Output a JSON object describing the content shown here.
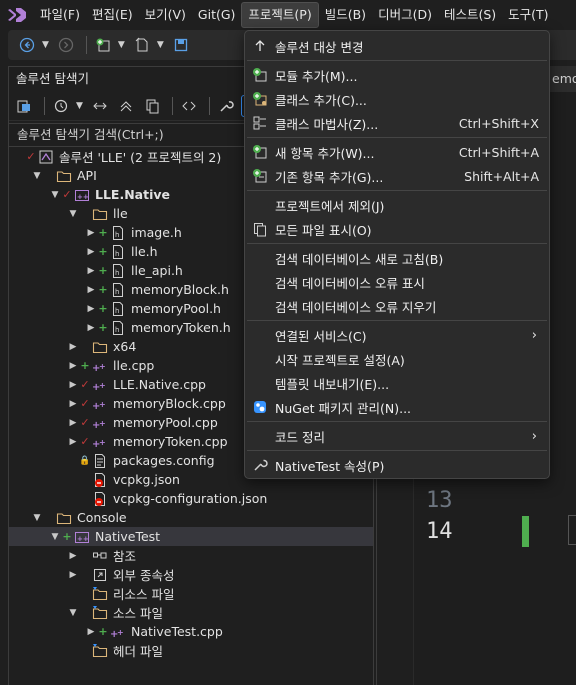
{
  "menubar": {
    "items": [
      "파일(F)",
      "편집(E)",
      "보기(V)",
      "Git(G)",
      "프로젝트(P)",
      "빌드(B)",
      "디버그(D)",
      "테스트(S)",
      "도구(T)"
    ],
    "active_index": 4
  },
  "toolbar": {
    "run_label": "▶ "
  },
  "solution_explorer": {
    "title": "솔루션 탐색기",
    "search_placeholder": "솔루션 탐색기 검색(Ctrl+;)",
    "tree": [
      {
        "label": "솔루션 'LLE'  (2 프로젝트의 2)",
        "depth": 0,
        "expander": "",
        "status": "check",
        "icon": "solution-icon",
        "bold": false
      },
      {
        "label": "API",
        "depth": 1,
        "expander": "▼",
        "status": "",
        "icon": "folder-icon",
        "bold": false
      },
      {
        "label": "LLE.Native",
        "depth": 2,
        "expander": "▼",
        "status": "check",
        "icon": "cpp-project-icon",
        "bold": true
      },
      {
        "label": "lle",
        "depth": 3,
        "expander": "▼",
        "status": "",
        "icon": "folder-icon",
        "bold": false
      },
      {
        "label": "image.h",
        "depth": 4,
        "expander": "▶",
        "status": "plus",
        "icon": "header-file-icon",
        "bold": false
      },
      {
        "label": "lle.h",
        "depth": 4,
        "expander": "▶",
        "status": "plus",
        "icon": "header-file-icon",
        "bold": false
      },
      {
        "label": "lle_api.h",
        "depth": 4,
        "expander": "▶",
        "status": "plus",
        "icon": "header-file-icon",
        "bold": false
      },
      {
        "label": "memoryBlock.h",
        "depth": 4,
        "expander": "▶",
        "status": "plus",
        "icon": "header-file-icon",
        "bold": false
      },
      {
        "label": "memoryPool.h",
        "depth": 4,
        "expander": "▶",
        "status": "plus",
        "icon": "header-file-icon",
        "bold": false
      },
      {
        "label": "memoryToken.h",
        "depth": 4,
        "expander": "▶",
        "status": "plus",
        "icon": "header-file-icon",
        "bold": false
      },
      {
        "label": "x64",
        "depth": 3,
        "expander": "▶",
        "status": "",
        "icon": "folder-icon",
        "bold": false
      },
      {
        "label": "lle.cpp",
        "depth": 3,
        "expander": "▶",
        "status": "plus",
        "icon": "cpp-file-icon",
        "bold": false
      },
      {
        "label": "LLE.Native.cpp",
        "depth": 3,
        "expander": "▶",
        "status": "check",
        "icon": "cpp-file-icon",
        "bold": false
      },
      {
        "label": "memoryBlock.cpp",
        "depth": 3,
        "expander": "▶",
        "status": "check",
        "icon": "cpp-file-icon",
        "bold": false
      },
      {
        "label": "memoryPool.cpp",
        "depth": 3,
        "expander": "▶",
        "status": "check",
        "icon": "cpp-file-icon",
        "bold": false
      },
      {
        "label": "memoryToken.cpp",
        "depth": 3,
        "expander": "▶",
        "status": "check",
        "icon": "cpp-file-icon",
        "bold": false
      },
      {
        "label": "packages.config",
        "depth": 3,
        "expander": "",
        "status": "lock",
        "icon": "config-file-icon",
        "bold": false
      },
      {
        "label": "vcpkg.json",
        "depth": 3,
        "expander": "",
        "status": "",
        "icon": "json-error-icon",
        "bold": false
      },
      {
        "label": "vcpkg-configuration.json",
        "depth": 3,
        "expander": "",
        "status": "",
        "icon": "json-error-icon",
        "bold": false
      },
      {
        "label": "Console",
        "depth": 1,
        "expander": "▼",
        "status": "",
        "icon": "folder-icon",
        "bold": false
      },
      {
        "label": "NativeTest",
        "depth": 2,
        "expander": "▼",
        "status": "plus",
        "icon": "cpp-project-icon",
        "bold": false,
        "selected": true
      },
      {
        "label": "참조",
        "depth": 3,
        "expander": "▶",
        "status": "",
        "icon": "references-icon",
        "bold": false
      },
      {
        "label": "외부 종속성",
        "depth": 3,
        "expander": "▶",
        "status": "",
        "icon": "external-deps-icon",
        "bold": false
      },
      {
        "label": "리소스 파일",
        "depth": 3,
        "expander": "",
        "status": "",
        "icon": "filter-folder-icon",
        "bold": false
      },
      {
        "label": "소스 파일",
        "depth": 3,
        "expander": "▼",
        "status": "",
        "icon": "filter-folder-icon",
        "bold": false
      },
      {
        "label": "NativeTest.cpp",
        "depth": 4,
        "expander": "▶",
        "status": "plus",
        "icon": "cpp-file-icon",
        "bold": false
      },
      {
        "label": "헤더 파일",
        "depth": 3,
        "expander": "",
        "status": "",
        "icon": "filter-folder-icon",
        "bold": false
      }
    ]
  },
  "editor": {
    "tab_label": "emor",
    "line_numbers": [
      "13",
      "14"
    ]
  },
  "project_menu": {
    "items": [
      {
        "label": "솔루션 대상 변경",
        "shortcut": "",
        "icon": "arrow-up-icon",
        "submenu": false,
        "sep_after": true
      },
      {
        "label": "모듈 추가(M)...",
        "shortcut": "",
        "icon": "add-module-icon",
        "submenu": false,
        "sep_after": false
      },
      {
        "label": "클래스 추가(C)...",
        "shortcut": "",
        "icon": "add-class-icon",
        "submenu": false,
        "sep_after": false
      },
      {
        "label": "클래스 마법사(Z)...",
        "shortcut": "Ctrl+Shift+X",
        "icon": "class-wizard-icon",
        "submenu": false,
        "sep_after": true
      },
      {
        "label": "새 항목 추가(W)...",
        "shortcut": "Ctrl+Shift+A",
        "icon": "add-new-item-icon",
        "submenu": false,
        "sep_after": false
      },
      {
        "label": "기존 항목 추가(G)...",
        "shortcut": "Shift+Alt+A",
        "icon": "add-existing-item-icon",
        "submenu": false,
        "sep_after": true
      },
      {
        "label": "프로젝트에서 제외(J)",
        "shortcut": "",
        "icon": "",
        "submenu": false,
        "sep_after": false
      },
      {
        "label": "모든 파일 표시(O)",
        "shortcut": "",
        "icon": "show-all-files-icon",
        "submenu": false,
        "sep_after": true
      },
      {
        "label": "검색 데이터베이스 새로 고침(B)",
        "shortcut": "",
        "icon": "",
        "submenu": false,
        "sep_after": false
      },
      {
        "label": "검색 데이터베이스 오류 표시",
        "shortcut": "",
        "icon": "",
        "submenu": false,
        "sep_after": false
      },
      {
        "label": "검색 데이터베이스 오류 지우기",
        "shortcut": "",
        "icon": "",
        "submenu": false,
        "sep_after": true
      },
      {
        "label": "연결된 서비스(C)",
        "shortcut": "",
        "icon": "",
        "submenu": true,
        "sep_after": false
      },
      {
        "label": "시작 프로젝트로 설정(A)",
        "shortcut": "",
        "icon": "",
        "submenu": false,
        "sep_after": false
      },
      {
        "label": "템플릿 내보내기(E)...",
        "shortcut": "",
        "icon": "",
        "submenu": false,
        "sep_after": false
      },
      {
        "label": "NuGet 패키지 관리(N)...",
        "shortcut": "",
        "icon": "nuget-icon",
        "submenu": false,
        "sep_after": true
      },
      {
        "label": "코드 정리",
        "shortcut": "",
        "icon": "",
        "submenu": true,
        "sep_after": true
      },
      {
        "label": "NativeTest 속성(P)",
        "shortcut": "",
        "icon": "wrench-icon",
        "submenu": false,
        "sep_after": false
      }
    ]
  },
  "colors": {
    "accent": "#3794ff",
    "vs_purple": "#b180d7",
    "modified_check": "#c23a3a",
    "added_plus": "#4fae4f",
    "error": "#e51400"
  }
}
